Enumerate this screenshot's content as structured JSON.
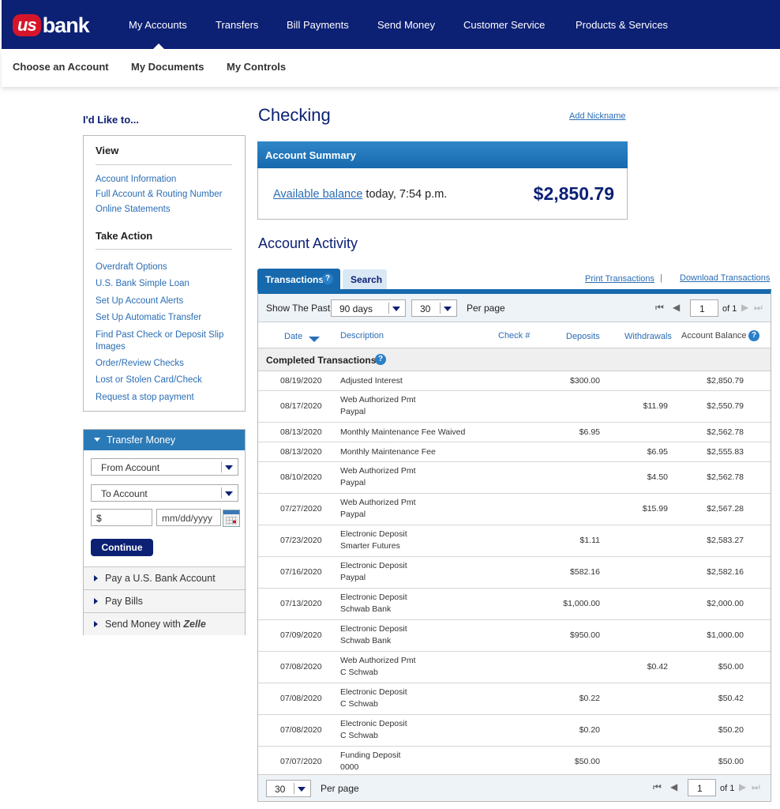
{
  "brand": {
    "us": "us",
    "bank": "bank"
  },
  "top_nav": [
    "My Accounts",
    "Transfers",
    "Bill Payments",
    "Send Money",
    "Customer Service",
    "Products & Services"
  ],
  "sub_nav": [
    "Choose an Account",
    "My Documents",
    "My Controls"
  ],
  "sidebar": {
    "heading": "I'd Like to...",
    "view_heading": "View",
    "view_links": [
      "Account Information",
      "Full Account & Routing Number",
      "Online Statements"
    ],
    "action_heading": "Take Action",
    "action_links": [
      "Overdraft Options",
      "U.S. Bank Simple Loan",
      "Set Up Account Alerts",
      "Set Up Automatic Transfer",
      "Find Past Check or Deposit Slip Images",
      "Order/Review Checks",
      "Lost or Stolen Card/Check",
      "Request a stop payment"
    ],
    "transfer": {
      "title": "Transfer Money",
      "from": "From Account",
      "to": "To Account",
      "amount": "$",
      "date_placeholder": "mm/dd/yyyy",
      "continue": "Continue"
    },
    "accordion": [
      "Pay a U.S. Bank Account",
      "Pay Bills",
      "Send Money with"
    ],
    "zelle": "Zelle"
  },
  "main": {
    "title": "Checking",
    "add_nickname": "Add Nickname",
    "summary_title": "Account Summary",
    "available_balance_label": "Available balance",
    "available_balance_time": " today, 7:54 p.m.",
    "balance": "$2,850.79",
    "activity_title": "Account Activity",
    "tabs": [
      "Transactions",
      "Search"
    ],
    "print_link": "Print Transactions",
    "pipe": "|",
    "download_link": "Download Transactions",
    "filter": {
      "show_past_label": "Show The Past",
      "days": "90 days",
      "per_page_count": "30",
      "per_page_label": "Per page",
      "page": "1",
      "of_label": "of 1"
    },
    "columns": [
      "Date",
      "Description",
      "Check #",
      "Deposits",
      "Withdrawals",
      "Account Balance"
    ],
    "completed_label": "Completed Transactions",
    "transactions": [
      {
        "date": "08/19/2020",
        "desc1": "Adjusted Interest",
        "desc2": "",
        "deposit": "$300.00",
        "withdrawal": "",
        "balance": "$2,850.79"
      },
      {
        "date": "08/17/2020",
        "desc1": "Web Authorized Pmt",
        "desc2": "Paypal",
        "deposit": "",
        "withdrawal": "$11.99",
        "balance": "$2,550.79"
      },
      {
        "date": "08/13/2020",
        "desc1": "Monthly Maintenance Fee Waived",
        "desc2": "",
        "deposit": "$6.95",
        "withdrawal": "",
        "balance": "$2,562.78"
      },
      {
        "date": "08/13/2020",
        "desc1": "Monthly Maintenance Fee",
        "desc2": "",
        "deposit": "",
        "withdrawal": "$6.95",
        "balance": "$2,555.83"
      },
      {
        "date": "08/10/2020",
        "desc1": "Web Authorized Pmt",
        "desc2": "Paypal",
        "deposit": "",
        "withdrawal": "$4.50",
        "balance": "$2,562.78"
      },
      {
        "date": "07/27/2020",
        "desc1": "Web Authorized Pmt",
        "desc2": "Paypal",
        "deposit": "",
        "withdrawal": "$15.99",
        "balance": "$2,567.28"
      },
      {
        "date": "07/23/2020",
        "desc1": "Electronic Deposit",
        "desc2": "Smarter Futures",
        "deposit": "$1.11",
        "withdrawal": "",
        "balance": "$2,583.27"
      },
      {
        "date": "07/16/2020",
        "desc1": "Electronic Deposit",
        "desc2": "Paypal",
        "deposit": "$582.16",
        "withdrawal": "",
        "balance": "$2,582.16"
      },
      {
        "date": "07/13/2020",
        "desc1": "Electronic Deposit",
        "desc2": "Schwab Bank",
        "deposit": "$1,000.00",
        "withdrawal": "",
        "balance": "$2,000.00"
      },
      {
        "date": "07/09/2020",
        "desc1": "Electronic Deposit",
        "desc2": "Schwab Bank",
        "deposit": "$950.00",
        "withdrawal": "",
        "balance": "$1,000.00"
      },
      {
        "date": "07/08/2020",
        "desc1": "Web Authorized Pmt",
        "desc2": "C Schwab",
        "deposit": "",
        "withdrawal": "$0.42",
        "balance": "$50.00"
      },
      {
        "date": "07/08/2020",
        "desc1": "Electronic Deposit",
        "desc2": "C Schwab",
        "deposit": "$0.22",
        "withdrawal": "",
        "balance": "$50.42"
      },
      {
        "date": "07/08/2020",
        "desc1": "Electronic Deposit",
        "desc2": "C Schwab",
        "deposit": "$0.20",
        "withdrawal": "",
        "balance": "$50.20"
      },
      {
        "date": "07/07/2020",
        "desc1": "Funding Deposit",
        "desc2": "0000",
        "deposit": "$50.00",
        "withdrawal": "",
        "balance": "$50.00"
      }
    ]
  },
  "colors": {
    "navy": "#0c2074",
    "red": "#d6152b",
    "blue": "#1769ad",
    "link": "#2a6db4"
  }
}
